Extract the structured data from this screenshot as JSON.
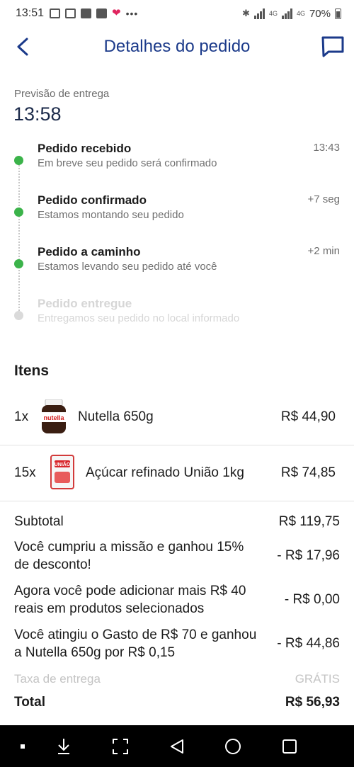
{
  "status_bar": {
    "time": "13:51",
    "net_label_1": "4G",
    "net_label_2": "4G",
    "battery": "70%"
  },
  "header": {
    "title": "Detalhes do pedido",
    "back_icon": "chevron-left-icon",
    "chat_icon": "chat-icon",
    "accent_color": "#1b3a8a"
  },
  "forecast": {
    "label": "Previsão de entrega",
    "time": "13:58"
  },
  "timeline": [
    {
      "title": "Pedido recebido",
      "desc": "Em breve seu pedido será confirmado",
      "time": "13:43",
      "done": true
    },
    {
      "title": "Pedido confirmado",
      "desc": "Estamos montando seu pedido",
      "time": "+7 seg",
      "done": true
    },
    {
      "title": "Pedido a caminho",
      "desc": "Estamos levando seu pedido até você",
      "time": "+2 min",
      "done": true
    },
    {
      "title": "Pedido entregue",
      "desc": "Entregamos seu pedido no local informado",
      "time": "",
      "done": false
    }
  ],
  "items": {
    "title": "Itens",
    "list": [
      {
        "qty": "1x",
        "name": "Nutella 650g",
        "price": "R$ 44,90"
      },
      {
        "qty": "15x",
        "name": "Açúcar refinado União 1kg",
        "price": "R$ 74,85"
      }
    ]
  },
  "summary": {
    "subtotal_label": "Subtotal",
    "subtotal_value": "R$ 119,75",
    "discounts": [
      {
        "label": "Você cumpriu a missão e ganhou 15% de desconto!",
        "value": "- R$ 17,96"
      },
      {
        "label": "Agora você pode adicionar mais R$ 40 reais em produtos selecionados",
        "value": "- R$ 0,00"
      },
      {
        "label": "Você atingiu o Gasto de R$ 70 e ganhou a Nutella 650g por R$ 0,15",
        "value": "- R$ 44,86"
      }
    ],
    "delivery_label": "Taxa de entrega",
    "delivery_value": "GRÁTIS",
    "total_label": "Total",
    "total_value": "R$ 56,93"
  },
  "colors": {
    "done": "#3bb34a",
    "pending": "#dadada"
  }
}
